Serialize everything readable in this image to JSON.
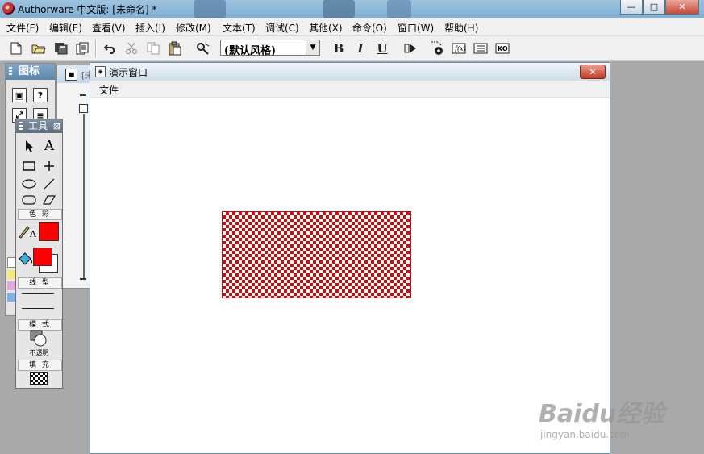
{
  "app": {
    "title": "Authorware 中文版: [未命名] *"
  },
  "window_controls": {
    "minimize": "—",
    "maximize": "□",
    "close": "✕"
  },
  "menu": [
    "文件(F)",
    "编辑(E)",
    "查看(V)",
    "插入(I)",
    "修改(M)",
    "文本(T)",
    "调试(C)",
    "其他(X)",
    "命令(O)",
    "窗口(W)",
    "帮助(H)"
  ],
  "toolbar": {
    "text_style_value": "(默认风格)",
    "bold_label": "B",
    "italic_label": "I",
    "underline_label": "U",
    "icons": [
      "new-file-icon",
      "open-folder-icon",
      "save-all-icon",
      "import-icon",
      "undo-icon",
      "cut-icon",
      "copy-icon",
      "paste-icon",
      "find-icon",
      "run-icon",
      "control-panel-icon",
      "functions-icon",
      "variables-icon",
      "knowledge-objects-icon"
    ]
  },
  "icon_palette": {
    "title": "图标"
  },
  "flow_window": {
    "title": "[未"
  },
  "tools_panel": {
    "title": "工具",
    "colors_label": "色 彩",
    "line_label": "线 型",
    "mode_label": "模 式",
    "mode_value": "不透明",
    "fill_label": "填 充",
    "text_color": "#ff0000",
    "fill_color": "#ff0000"
  },
  "presentation_window": {
    "title": "演示窗口",
    "menu_file": "文件",
    "rect_fill_color": "#c41010"
  },
  "watermark": {
    "brand": "Baidu经验",
    "url": "jingyan.baidu.com"
  }
}
